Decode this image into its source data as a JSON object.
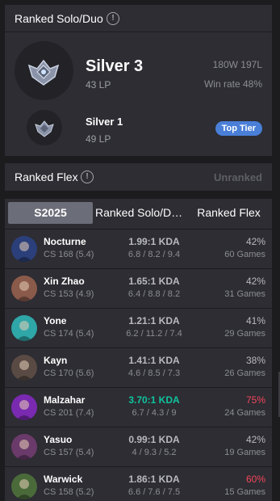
{
  "solo": {
    "title": "Ranked Solo/Duo",
    "info_icon": "info-icon",
    "current": {
      "tier": "Silver 3",
      "lp": "43 LP",
      "wins_losses": "180W 197L",
      "win_rate": "Win rate 48%"
    },
    "peak": {
      "tier": "Silver 1",
      "lp": "49 LP",
      "badge": "Top Tier"
    }
  },
  "flex": {
    "title": "Ranked Flex",
    "status": "Unranked"
  },
  "champions": {
    "tabs": [
      "S2025",
      "Ranked Solo/D…",
      "Ranked Flex"
    ],
    "rows": [
      {
        "name": "Nocturne",
        "cs": "CS 168 (5.4)",
        "kda": "1.99:1 KDA",
        "kda_detail": "6.8 / 8.2 / 9.4",
        "win_rate": "42%",
        "games": "60 Games",
        "kda_good": false,
        "wr_hot": false,
        "color": "#2b3f7a"
      },
      {
        "name": "Xin Zhao",
        "cs": "CS 153 (4.9)",
        "kda": "1.65:1 KDA",
        "kda_detail": "6.4 / 8.8 / 8.2",
        "win_rate": "42%",
        "games": "31 Games",
        "kda_good": false,
        "wr_hot": false,
        "color": "#8a5a4a"
      },
      {
        "name": "Yone",
        "cs": "CS 174 (5.4)",
        "kda": "1.21:1 KDA",
        "kda_detail": "6.2 / 11.2 / 7.4",
        "win_rate": "41%",
        "games": "29 Games",
        "kda_good": false,
        "wr_hot": false,
        "color": "#2fa6a8"
      },
      {
        "name": "Kayn",
        "cs": "CS 170 (5.6)",
        "kda": "1.41:1 KDA",
        "kda_detail": "4.6 / 8.5 / 7.3",
        "win_rate": "38%",
        "games": "26 Games",
        "kda_good": false,
        "wr_hot": false,
        "color": "#5a4a44"
      },
      {
        "name": "Malzahar",
        "cs": "CS 201 (7.4)",
        "kda": "3.70:1 KDA",
        "kda_detail": "6.7 / 4.3 / 9",
        "win_rate": "75%",
        "games": "24 Games",
        "kda_good": true,
        "wr_hot": true,
        "color": "#7a2ab0"
      },
      {
        "name": "Yasuo",
        "cs": "CS 157 (5.4)",
        "kda": "0.99:1 KDA",
        "kda_detail": "4 / 9.3 / 5.2",
        "win_rate": "42%",
        "games": "19 Games",
        "kda_good": false,
        "wr_hot": false,
        "color": "#6a3a6a"
      },
      {
        "name": "Warwick",
        "cs": "CS 158 (5.2)",
        "kda": "1.86:1 KDA",
        "kda_detail": "6.6 / 7.6 / 7.5",
        "win_rate": "60%",
        "games": "15 Games",
        "kda_good": false,
        "wr_hot": true,
        "color": "#4a6a3a"
      }
    ]
  }
}
